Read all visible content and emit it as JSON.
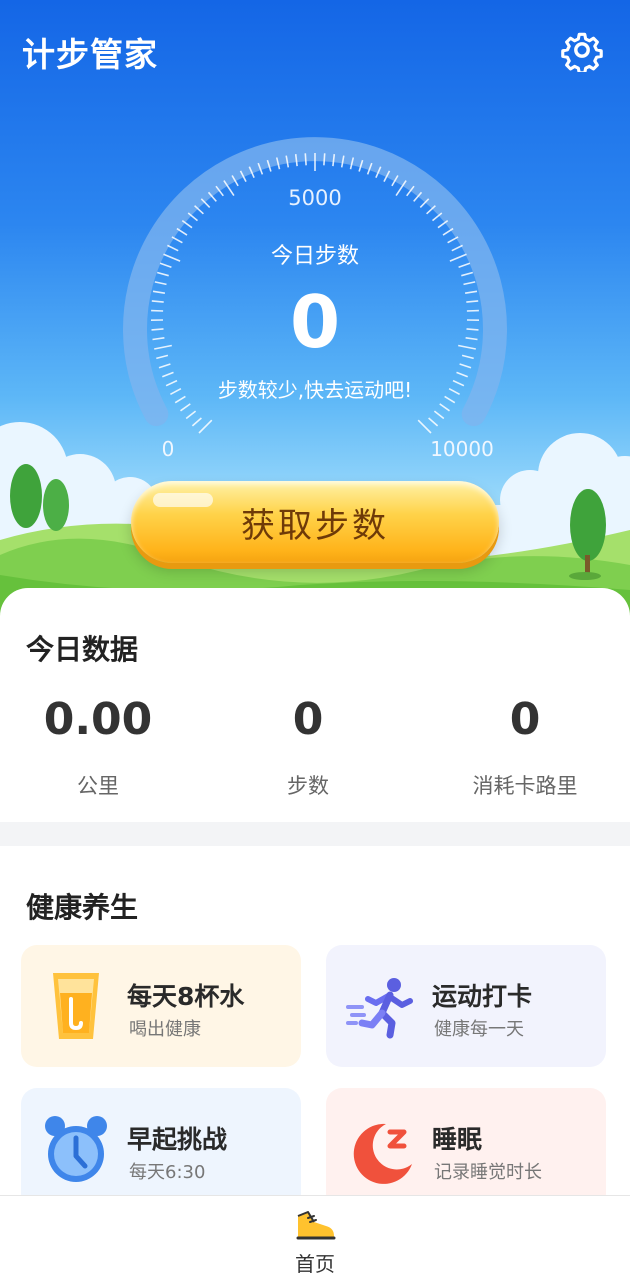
{
  "app": {
    "title": "计步管家"
  },
  "gauge": {
    "title": "今日步数",
    "steps": "0",
    "hint": "步数较少,快去运动吧!",
    "min_label": "0",
    "mid_label": "5000",
    "max_label": "10000",
    "progress": 0
  },
  "cta": {
    "label": "获取步数"
  },
  "today": {
    "title": "今日数据",
    "stats": [
      {
        "value": "0.00",
        "label": "公里"
      },
      {
        "value": "0",
        "label": "步数"
      },
      {
        "value": "0",
        "label": "消耗卡路里"
      }
    ]
  },
  "health": {
    "title": "健康养生",
    "tiles": [
      {
        "title": "每天8杯水",
        "subtitle": "喝出健康",
        "icon": "water-cup-icon",
        "bg": "#fff6e6"
      },
      {
        "title": "运动打卡",
        "subtitle": "健康每一天",
        "icon": "running-person-icon",
        "bg": "#f2f3fd"
      },
      {
        "title": "早起挑战",
        "subtitle": "每天6:30",
        "icon": "alarm-clock-icon",
        "bg": "#eef5fe"
      },
      {
        "title": "睡眠",
        "subtitle": "记录睡觉时长",
        "icon": "moon-sleep-icon",
        "bg": "#fff1ef"
      }
    ]
  },
  "nav": {
    "home_label": "首页",
    "home_icon": "sneaker-icon"
  },
  "colors": {
    "hero_blue": "#1466e6",
    "button_gold": "#ffc22e",
    "button_text": "#6e3a08"
  }
}
